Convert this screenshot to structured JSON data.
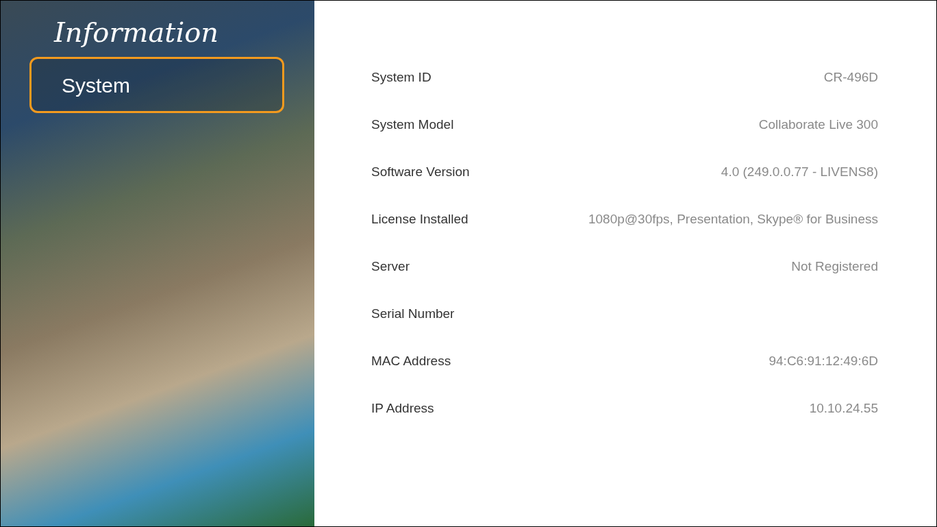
{
  "sidebar": {
    "title": "Information",
    "items": [
      {
        "label": "System",
        "selected": true
      }
    ]
  },
  "info_rows": [
    {
      "label": "System ID",
      "value": "CR-496D"
    },
    {
      "label": "System Model",
      "value": "Collaborate Live 300"
    },
    {
      "label": "Software Version",
      "value": "4.0 (249.0.0.77 - LIVENS8)"
    },
    {
      "label": "License Installed",
      "value": "1080p@30fps, Presentation, Skype® for Business"
    },
    {
      "label": "Server",
      "value": "Not Registered"
    },
    {
      "label": "Serial Number"
    },
    {
      "label": "MAC Address",
      "value": "94:C6:91:12:49:6D"
    },
    {
      "label": "IP Address",
      "value": "10.10.24.55"
    }
  ]
}
